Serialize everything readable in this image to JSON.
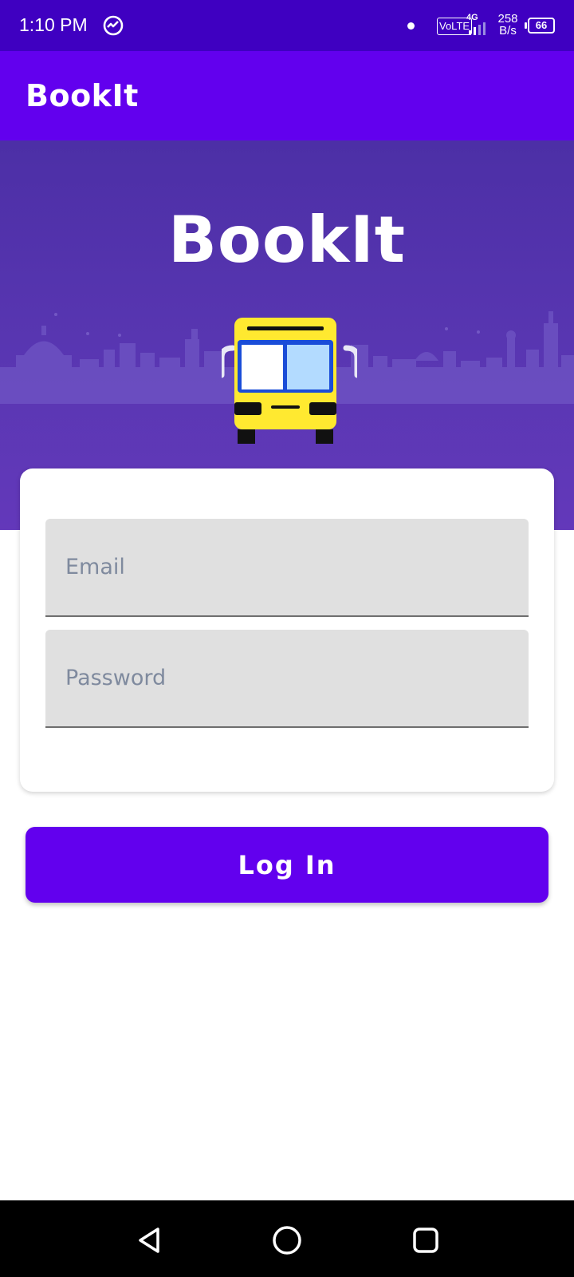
{
  "status_bar": {
    "time": "1:10 PM",
    "network_label": "VoLTE",
    "network_type": "4G",
    "speed": "258 B/s",
    "battery": "66",
    "icons": [
      "activity-icon",
      "notification-dot-icon",
      "signal-icon",
      "battery-icon"
    ]
  },
  "app_bar": {
    "title": "BookIt"
  },
  "hero": {
    "logo_text": "BookIt",
    "illustration": "bus-icon"
  },
  "login_form": {
    "email_placeholder": "Email",
    "password_placeholder": "Password",
    "email_value": "",
    "password_value": "",
    "submit_label": "Log In"
  },
  "nav_bar": {
    "buttons": [
      "back-icon",
      "home-icon",
      "recents-icon"
    ]
  },
  "colors": {
    "status_bar": "#3F00C1",
    "primary": "#6200EE",
    "hero_bg": "#5235AE",
    "field_bg": "#E0E0E0",
    "placeholder": "#7F8A9E",
    "bus_yellow": "#FFE930",
    "bus_window_light": "#B3DBFF",
    "bus_frame_blue": "#1A4DD8"
  }
}
